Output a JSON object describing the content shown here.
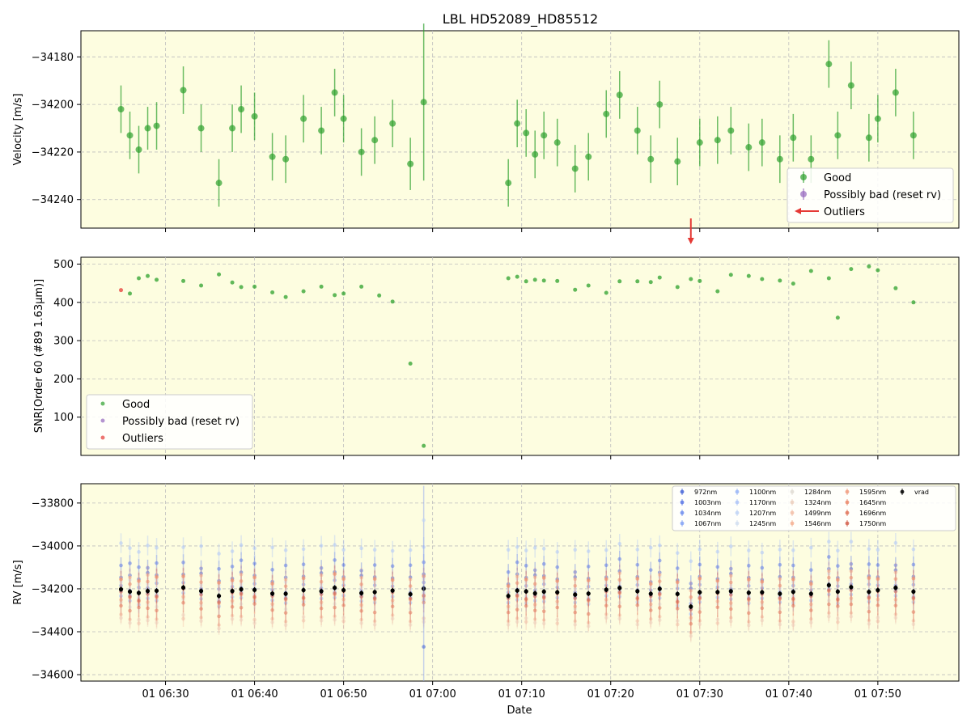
{
  "figure": {
    "title": "LBL HD52089_HD85512",
    "xlabel": "Date",
    "x_ticks": [
      "01 06:30",
      "01 06:40",
      "01 06:50",
      "01 07:00",
      "01 07:10",
      "01 07:20",
      "01 07:30",
      "01 07:40",
      "01 07:50"
    ]
  },
  "colors": {
    "background": "#fdfde0",
    "good": "#2ca02c",
    "possibly_bad": "#9467bd",
    "outlier": "#e53935",
    "vrad": "#000000"
  },
  "chart_data": [
    {
      "type": "scatter",
      "panel": "velocity",
      "ylabel": "Velocity [m/s]",
      "ylim": [
        -34252,
        -34169
      ],
      "y_ticks": [
        -34180,
        -34200,
        -34220,
        -34240
      ],
      "grid": true,
      "legend_position": "lower-right",
      "legend": [
        "Good",
        "Possibly bad (reset rv)",
        "Outliers"
      ],
      "outlier_arrow_time": "07:29",
      "series": [
        {
          "name": "Good",
          "time": [
            "06:25",
            "06:26",
            "06:27",
            "06:28",
            "06:29",
            "06:32",
            "06:34",
            "06:36",
            "06:37.5",
            "06:38.5",
            "06:40",
            "06:42",
            "06:43.5",
            "06:45.5",
            "06:47.5",
            "06:49",
            "06:50",
            "06:52",
            "06:53.5",
            "06:55.5",
            "06:57.5",
            "06:59",
            "07:08.5",
            "07:09.5",
            "07:10.5",
            "07:11.5",
            "07:12.5",
            "07:14",
            "07:16",
            "07:17.5",
            "07:19.5",
            "07:21",
            "07:23",
            "07:24.5",
            "07:25.5",
            "07:27.5",
            "07:30",
            "07:32",
            "07:33.5",
            "07:35.5",
            "07:37",
            "07:39",
            "07:40.5",
            "07:42.5",
            "07:44.5",
            "07:45.5",
            "07:47",
            "07:49",
            "07:50",
            "07:52",
            "07:54"
          ],
          "y": [
            -34202,
            -34213,
            -34219,
            -34210,
            -34209,
            -34194,
            -34210,
            -34233,
            -34210,
            -34202,
            -34205,
            -34222,
            -34223,
            -34206,
            -34211,
            -34195,
            -34206,
            -34220,
            -34215,
            -34208,
            -34225,
            -34199,
            -34233,
            -34208,
            -34212,
            -34221,
            -34213,
            -34216,
            -34227,
            -34222,
            -34204,
            -34196,
            -34211,
            -34223,
            -34200,
            -34224,
            -34216,
            -34215,
            -34211,
            -34218,
            -34216,
            -34223,
            -34214,
            -34223,
            -34183,
            -34213,
            -34192,
            -34214,
            -34206,
            -34195,
            -34213
          ],
          "yerr": [
            10,
            10,
            10,
            9,
            10,
            10,
            10,
            10,
            10,
            10,
            10,
            10,
            10,
            10,
            10,
            10,
            10,
            10,
            10,
            10,
            11,
            33,
            10,
            10,
            10,
            10,
            10,
            10,
            10,
            10,
            10,
            10,
            10,
            10,
            10,
            10,
            10,
            10,
            10,
            10,
            10,
            10,
            10,
            10,
            10,
            10,
            10,
            10,
            10,
            10,
            10
          ]
        },
        {
          "name": "Possibly bad (reset rv)",
          "time": [],
          "y": []
        }
      ]
    },
    {
      "type": "scatter",
      "panel": "snr",
      "ylabel": "SNR[Order 60 (#89 1.63μm)]",
      "ylim": [
        0,
        518
      ],
      "y_ticks": [
        100,
        200,
        300,
        400,
        500
      ],
      "grid": true,
      "legend_position": "lower-left",
      "legend": [
        "Good",
        "Possibly bad (reset rv)",
        "Outliers"
      ],
      "series": [
        {
          "name": "Good",
          "time": [
            "06:26",
            "06:27",
            "06:28",
            "06:29",
            "06:32",
            "06:34",
            "06:36",
            "06:37.5",
            "06:38.5",
            "06:40",
            "06:42",
            "06:43.5",
            "06:45.5",
            "06:47.5",
            "06:49",
            "06:50",
            "06:52",
            "06:54",
            "06:55.5",
            "06:57.5",
            "06:59",
            "07:08.5",
            "07:09.5",
            "07:10.5",
            "07:11.5",
            "07:12.5",
            "07:14",
            "07:16",
            "07:17.5",
            "07:19.5",
            "07:21",
            "07:23",
            "07:24.5",
            "07:25.5",
            "07:27.5",
            "07:29",
            "07:30",
            "07:32",
            "07:33.5",
            "07:35.5",
            "07:37",
            "07:39",
            "07:40.5",
            "07:42.5",
            "07:44.5",
            "07:45.5",
            "07:47",
            "07:49",
            "07:50",
            "07:52",
            "07:54"
          ],
          "y": [
            423,
            463,
            469,
            459,
            456,
            444,
            473,
            452,
            440,
            441,
            426,
            414,
            429,
            441,
            419,
            423,
            441,
            418,
            402,
            240,
            25,
            463,
            467,
            455,
            459,
            457,
            456,
            433,
            444,
            425,
            455,
            455,
            453,
            465,
            440,
            461,
            456,
            429,
            472,
            469,
            461,
            457,
            449,
            482,
            463,
            360,
            487,
            494,
            484,
            437,
            400
          ]
        },
        {
          "name": "Outliers",
          "time": [
            "06:25"
          ],
          "y": [
            432
          ]
        }
      ]
    },
    {
      "type": "scatter",
      "panel": "rv",
      "ylabel": "RV [m/s]",
      "ylim": [
        -34630,
        -33710
      ],
      "y_ticks": [
        -33800,
        -34000,
        -34200,
        -34400,
        -34600
      ],
      "grid": true,
      "legend_position": "upper-right",
      "legend": [
        "972nm",
        "1003nm",
        "1034nm",
        "1067nm",
        "1100nm",
        "1170nm",
        "1207nm",
        "1245nm",
        "1284nm",
        "1324nm",
        "1499nm",
        "1546nm",
        "1595nm",
        "1645nm",
        "1696nm",
        "1750nm",
        "vrad"
      ],
      "band_colors": [
        "#4a68d8",
        "#5e7ae6",
        "#7290ef",
        "#86a4f5",
        "#9ab6f7",
        "#aec6f8",
        "#c0d3f5",
        "#d2def0",
        "#e0dcd4",
        "#ecd0c0",
        "#f2c0a8",
        "#f4b093",
        "#f19e80",
        "#eb8a6c",
        "#e2765c",
        "#d4624f",
        "#000000"
      ],
      "band_offsets": [
        70,
        120,
        20,
        -10,
        -40,
        200,
        -20,
        40,
        -60,
        -140,
        -130,
        60,
        -40,
        50,
        -80,
        -20,
        0
      ],
      "series": [
        {
          "name": "vrad",
          "time": [
            "06:25",
            "06:26",
            "06:27",
            "06:28",
            "06:29",
            "06:32",
            "06:34",
            "06:36",
            "06:37.5",
            "06:38.5",
            "06:40",
            "06:42",
            "06:43.5",
            "06:45.5",
            "06:47.5",
            "06:49",
            "06:50",
            "06:52",
            "06:53.5",
            "06:55.5",
            "06:57.5",
            "06:59",
            "07:08.5",
            "07:09.5",
            "07:10.5",
            "07:11.5",
            "07:12.5",
            "07:14",
            "07:16",
            "07:17.5",
            "07:19.5",
            "07:21",
            "07:23",
            "07:24.5",
            "07:25.5",
            "07:27.5",
            "07:29",
            "07:30",
            "07:32",
            "07:33.5",
            "07:35.5",
            "07:37",
            "07:39",
            "07:40.5",
            "07:42.5",
            "07:44.5",
            "07:45.5",
            "07:47",
            "07:49",
            "07:50",
            "07:52",
            "07:54"
          ],
          "y": [
            -34202,
            -34213,
            -34219,
            -34210,
            -34209,
            -34194,
            -34210,
            -34233,
            -34210,
            -34202,
            -34205,
            -34222,
            -34223,
            -34206,
            -34211,
            -34195,
            -34206,
            -34220,
            -34215,
            -34208,
            -34225,
            -34199,
            -34233,
            -34208,
            -34212,
            -34221,
            -34213,
            -34216,
            -34227,
            -34222,
            -34204,
            -34196,
            -34211,
            -34223,
            -34200,
            -34224,
            -34283,
            -34216,
            -34215,
            -34211,
            -34218,
            -34216,
            -34223,
            -34214,
            -34223,
            -34183,
            -34213,
            -34192,
            -34214,
            -34206,
            -34195,
            -34213
          ]
        }
      ]
    }
  ]
}
